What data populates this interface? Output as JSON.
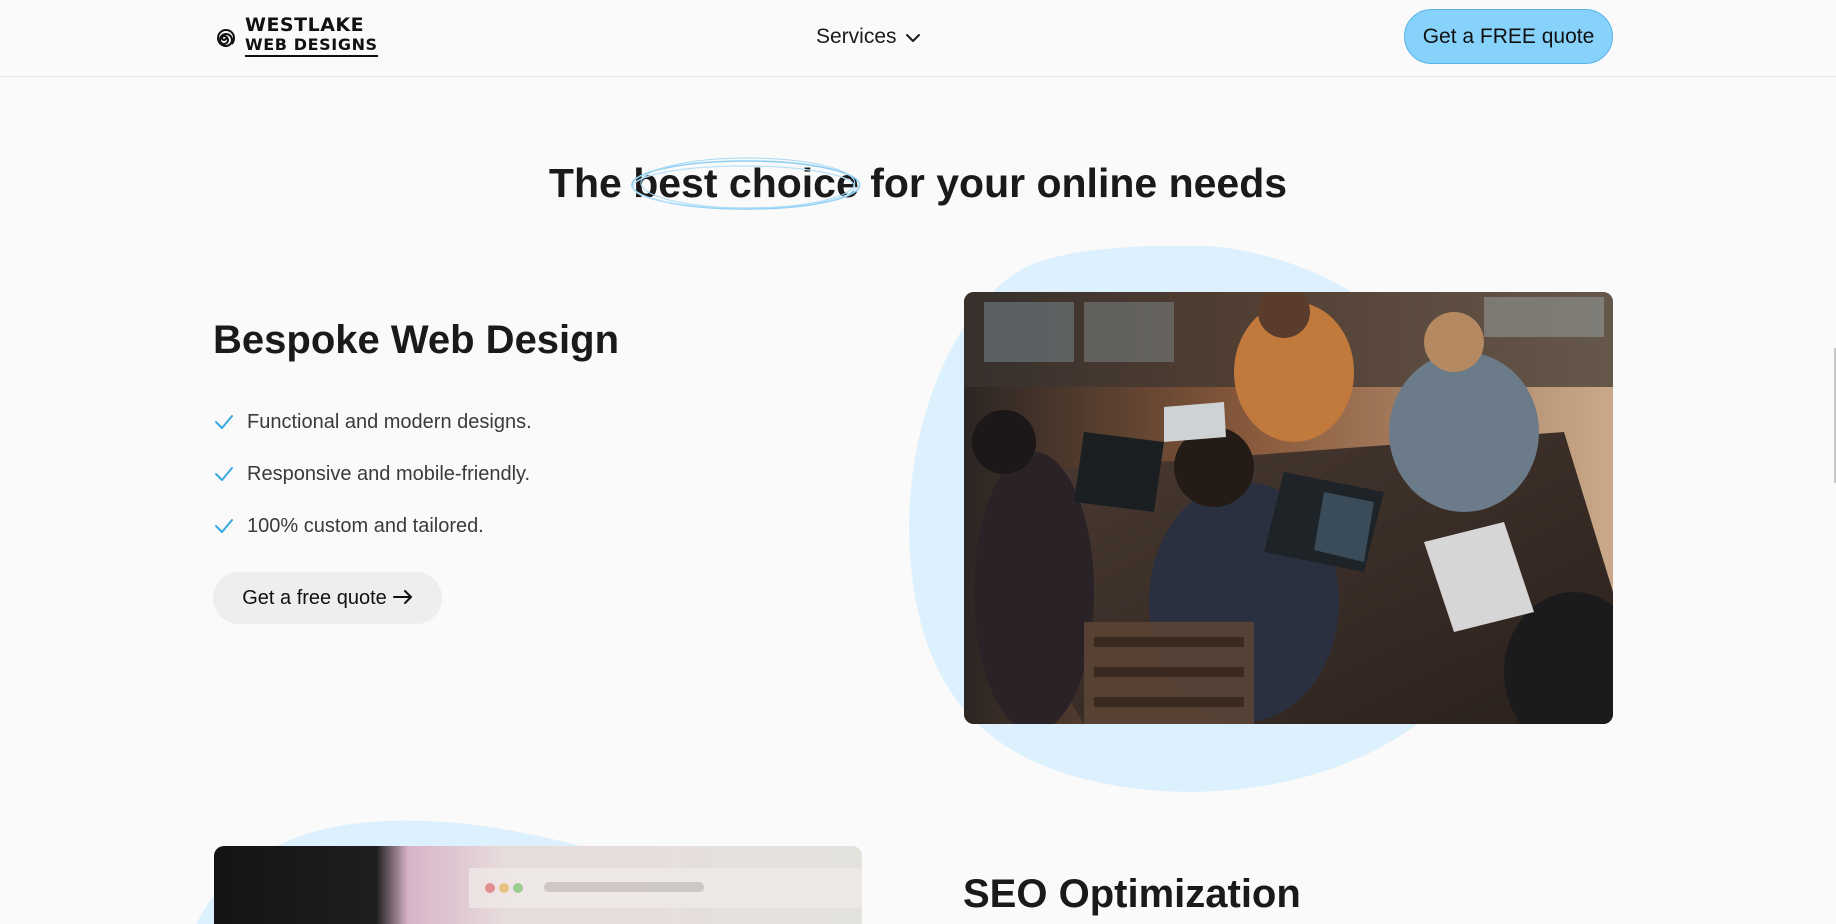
{
  "header": {
    "logo": {
      "line1": "WESTLAKE",
      "line2": "WEB DESIGNS",
      "icon": "spiral-logo-icon"
    },
    "nav": {
      "services_label": "Services",
      "services_icon": "chevron-down-icon"
    },
    "cta_label": "Get a FREE quote"
  },
  "hero": {
    "headline_pre": "The ",
    "headline_highlight": "best choice",
    "headline_post": " for your online needs"
  },
  "features": [
    {
      "title": "Bespoke Web Design",
      "points": [
        "Functional and modern designs.",
        "Responsive and mobile-friendly.",
        "100% custom and tailored."
      ],
      "button_label": "Get a free quote",
      "button_icon": "arrow-right-icon",
      "image": "team-working-on-laptops-photo"
    },
    {
      "title": "SEO Optimization",
      "image": "browser-address-bar-photo"
    }
  ],
  "colors": {
    "accent": "#86d2fb",
    "accent_border": "#5ab4e6",
    "blob": "#ddf0fd",
    "check": "#3aa6e0",
    "text": "#1a1a1a",
    "background": "#fafafa"
  }
}
